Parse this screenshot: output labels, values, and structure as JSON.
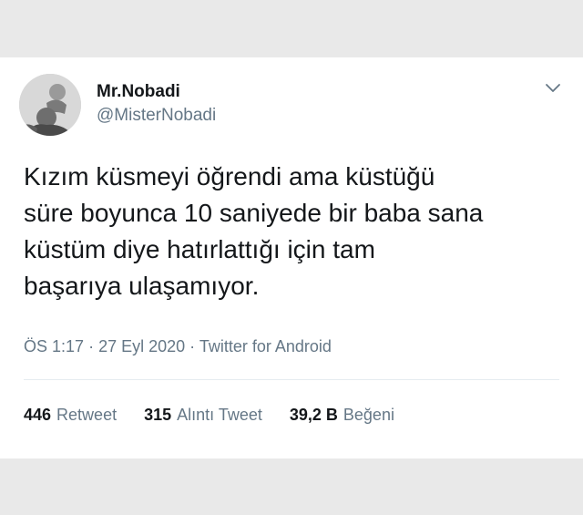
{
  "tweet": {
    "author_name": "Mr.Nobadi",
    "author_handle": "@MisterNobadi",
    "text_lines": [
      "Kızım küsmeyi öğrendi ama küstüğü",
      "süre boyunca 10 saniyede bir baba sana",
      "küstüm diye hatırlattığı için tam",
      "başarıya ulaşamıyor."
    ],
    "meta": {
      "time": "ÖS 1:17",
      "separator": "·",
      "date": "27 Eyl 2020",
      "source": "Twitter for Android"
    },
    "stats": [
      {
        "count": "446",
        "label": "Retweet"
      },
      {
        "count": "315",
        "label": "Alıntı Tweet"
      },
      {
        "count": "39,2 B",
        "label": "Beğeni"
      }
    ]
  },
  "colors": {
    "background": "#e9e9e9",
    "card": "#ffffff",
    "text_primary": "#14171a",
    "text_secondary": "#657786",
    "divider": "#e6ecf0"
  },
  "icons": {
    "menu": "chevron-down-icon",
    "avatar": "avatar"
  }
}
